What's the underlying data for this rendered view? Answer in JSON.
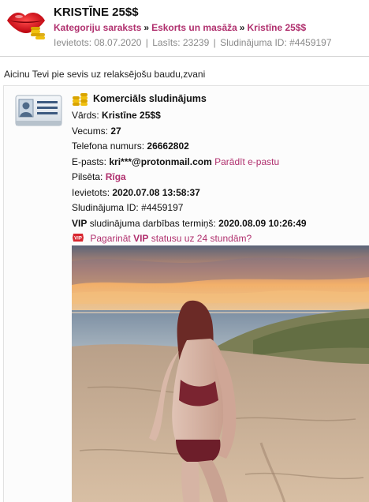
{
  "header": {
    "title": "KRISTĪNE 25$$",
    "breadcrumb": [
      "Kategoriju saraksts",
      "Eskorts un masāža",
      "Kristīne 25$$"
    ],
    "breadcrumb_separator": "»",
    "meta": {
      "posted": "Ievietots: 08.07.2020",
      "views": "Lasīts: 23239",
      "ad_id": "Sludinājuma ID: #4459197"
    }
  },
  "intro_text": "Aicinu Tevi pie sevis uz relaksējošu baudu,zvani",
  "ad": {
    "heading": "Komerciāls sludinājums",
    "name_label": "Vārds:",
    "name_value": "Kristīne 25$$",
    "age_label": "Vecums:",
    "age_value": "27",
    "phone_label": "Telefona numurs:",
    "phone_value": "26662802",
    "email_label": "E-pasts:",
    "email_value": "kri***@protonmail.com",
    "show_email_link": "Parādīt e-pastu",
    "city_label": "Pilsēta:",
    "city_value": "Rīga",
    "posted_label": "Ievietots:",
    "posted_value": "2020.07.08 13:58:37",
    "id_label": "Sludinājuma ID:",
    "id_value": "#4459197",
    "vip_prefix": "VIP",
    "vip_label": "sludinājuma darbības termiņš:",
    "vip_value": "2020.08.09 10:26:49",
    "extend_pre": "Pagarināt",
    "extend_vip": "VIP",
    "extend_post": "statusu uz 24 stundām?",
    "vip_badge_text": "VIP"
  },
  "colors": {
    "link": "#b0306e",
    "meta": "#8a8a8a",
    "divider": "#d6d6d6"
  },
  "icons": {
    "logo": "lips-with-coins-icon",
    "card": "contact-card-icon",
    "coins": "coins-icon",
    "vip": "vip-badge-icon"
  }
}
